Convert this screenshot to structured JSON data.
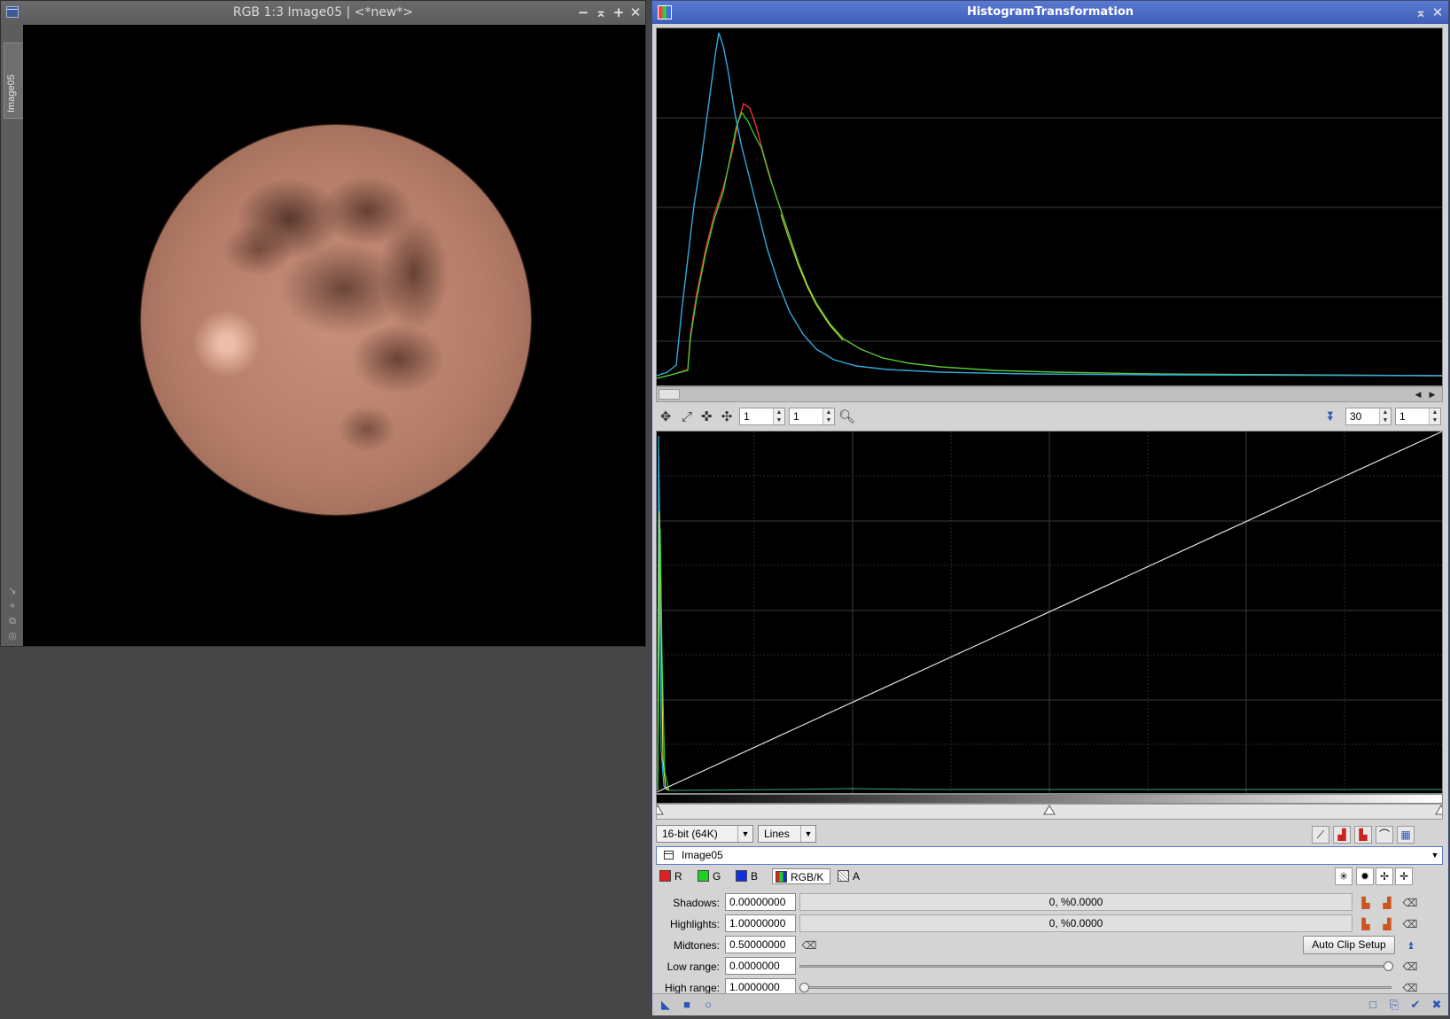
{
  "image_window": {
    "title": "RGB 1:3 Image05 | <*new*>",
    "side_tab": "Image05",
    "buttons": [
      "minimize-icon",
      "shade-icon",
      "maximize-icon",
      "close-icon"
    ]
  },
  "histogram_window": {
    "title": "HistogramTransformation",
    "zoom": {
      "x": "1",
      "y": "1"
    },
    "rejection": {
      "value": "30",
      "step": "1"
    },
    "resolution": "16-bit (64K)",
    "graph_style": "Lines",
    "view": "Image05",
    "channels": [
      {
        "label": "R",
        "color": "#e02020"
      },
      {
        "label": "G",
        "color": "#20d020"
      },
      {
        "label": "B",
        "color": "#1030e0"
      },
      {
        "label": "RGB/K",
        "color": "#888888"
      },
      {
        "label": "A",
        "color": "#ffffff"
      }
    ],
    "shadows": {
      "label": "Shadows:",
      "value": "0.00000000",
      "stats": "0, %0.0000"
    },
    "highlights": {
      "label": "Highlights:",
      "value": "1.00000000",
      "stats": "0, %0.0000"
    },
    "midtones": {
      "label": "Midtones:",
      "value": "0.50000000"
    },
    "low_range": {
      "label": "Low range:",
      "value": "0.0000000",
      "slider": 1.0
    },
    "high_range": {
      "label": "High range:",
      "value": "1.0000000",
      "slider": 0.0
    },
    "auto_clip": "Auto Clip Setup"
  }
}
